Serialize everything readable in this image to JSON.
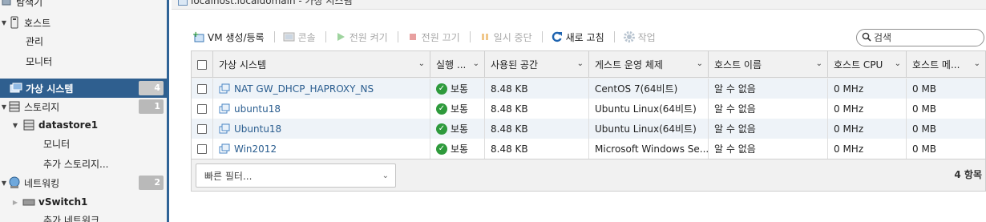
{
  "window": {
    "title": "localhost.localdomain - 가상 시스템"
  },
  "sidebar": {
    "top_label": "탐색기",
    "host": {
      "label": "호스트",
      "children": [
        "관리",
        "모니터"
      ]
    },
    "vms": {
      "label": "가상 시스템",
      "count": "4"
    },
    "storage": {
      "label": "스토리지",
      "count": "1",
      "datastore": "datastore1",
      "children": [
        "모니터",
        "추가 스토리지..."
      ]
    },
    "networking": {
      "label": "네트워킹",
      "count": "2",
      "vswitch": "vSwitch1",
      "more": "추가 네트워크..."
    }
  },
  "toolbar": {
    "create": "VM 생성/등록",
    "console": "콘솔",
    "power_on": "전원 켜기",
    "power_off": "전원 끄기",
    "suspend": "일시 중단",
    "refresh": "새로 고침",
    "actions": "작업"
  },
  "search": {
    "placeholder": "검색"
  },
  "grid": {
    "columns": [
      "가상 시스템",
      "실행 ...",
      "사용된 공간",
      "게스트 운영 체제",
      "호스트 이름",
      "호스트 CPU",
      "호스트 메..."
    ],
    "rows": [
      {
        "name": "NAT GW_DHCP_HAPROXY_NS",
        "status": "보통",
        "space": "8.48 KB",
        "os": "CentOS 7(64비트)",
        "hostname": "알 수 없음",
        "cpu": "0 MHz",
        "mem": "0 MB"
      },
      {
        "name": "ubuntu18",
        "status": "보통",
        "space": "8.48 KB",
        "os": "Ubuntu Linux(64비트)",
        "hostname": "알 수 없음",
        "cpu": "0 MHz",
        "mem": "0 MB"
      },
      {
        "name": "Ubuntu18",
        "status": "보통",
        "space": "8.48 KB",
        "os": "Ubuntu Linux(64비트)",
        "hostname": "알 수 없음",
        "cpu": "0 MHz",
        "mem": "0 MB"
      },
      {
        "name": "Win2012",
        "status": "보통",
        "space": "8.48 KB",
        "os": "Microsoft Windows Se...",
        "hostname": "알 수 없음",
        "cpu": "0 MHz",
        "mem": "0 MB"
      }
    ],
    "quick_filter": "빠른 필터...",
    "item_count": "4 항목"
  },
  "colors": {
    "accent": "#2f5f8f",
    "link": "#2a5d8f",
    "ok": "#2e9a3c",
    "refresh": "#1f64b0"
  }
}
